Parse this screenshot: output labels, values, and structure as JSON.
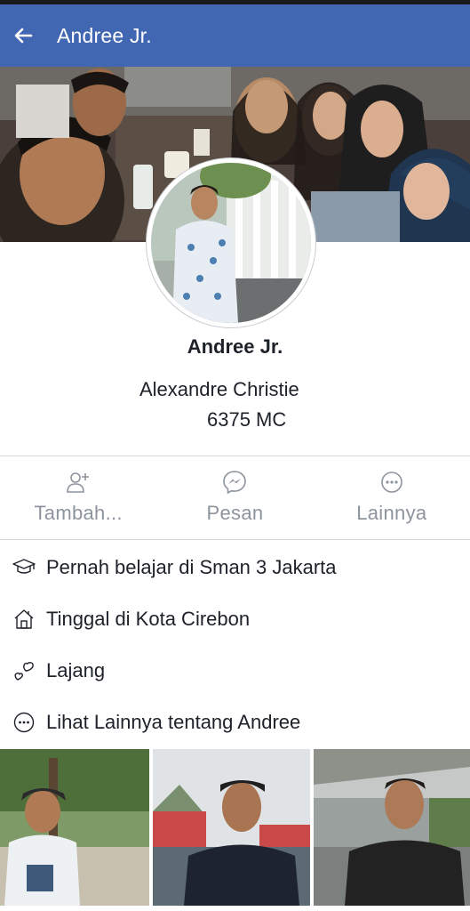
{
  "header": {
    "title": "Andree Jr.",
    "back_icon": "arrow-left-icon",
    "bg": "#4267b2"
  },
  "profile": {
    "name": "Andree Jr.",
    "bio_line1": "Alexandre Christie",
    "bio_line2": "6375 MC"
  },
  "actions": [
    {
      "label": "Tambah...",
      "icon": "add-friend-icon"
    },
    {
      "label": "Pesan",
      "icon": "messenger-icon"
    },
    {
      "label": "Lainnya",
      "icon": "more-icon"
    }
  ],
  "info": [
    {
      "text": "Pernah belajar di Sman 3 Jakarta",
      "icon": "graduation-cap-icon"
    },
    {
      "text": "Tinggal di Kota Cirebon",
      "icon": "home-icon"
    },
    {
      "text": "Lajang",
      "icon": "hearts-icon"
    },
    {
      "text": "Lihat Lainnya tentang Andree",
      "icon": "more-icon"
    }
  ]
}
